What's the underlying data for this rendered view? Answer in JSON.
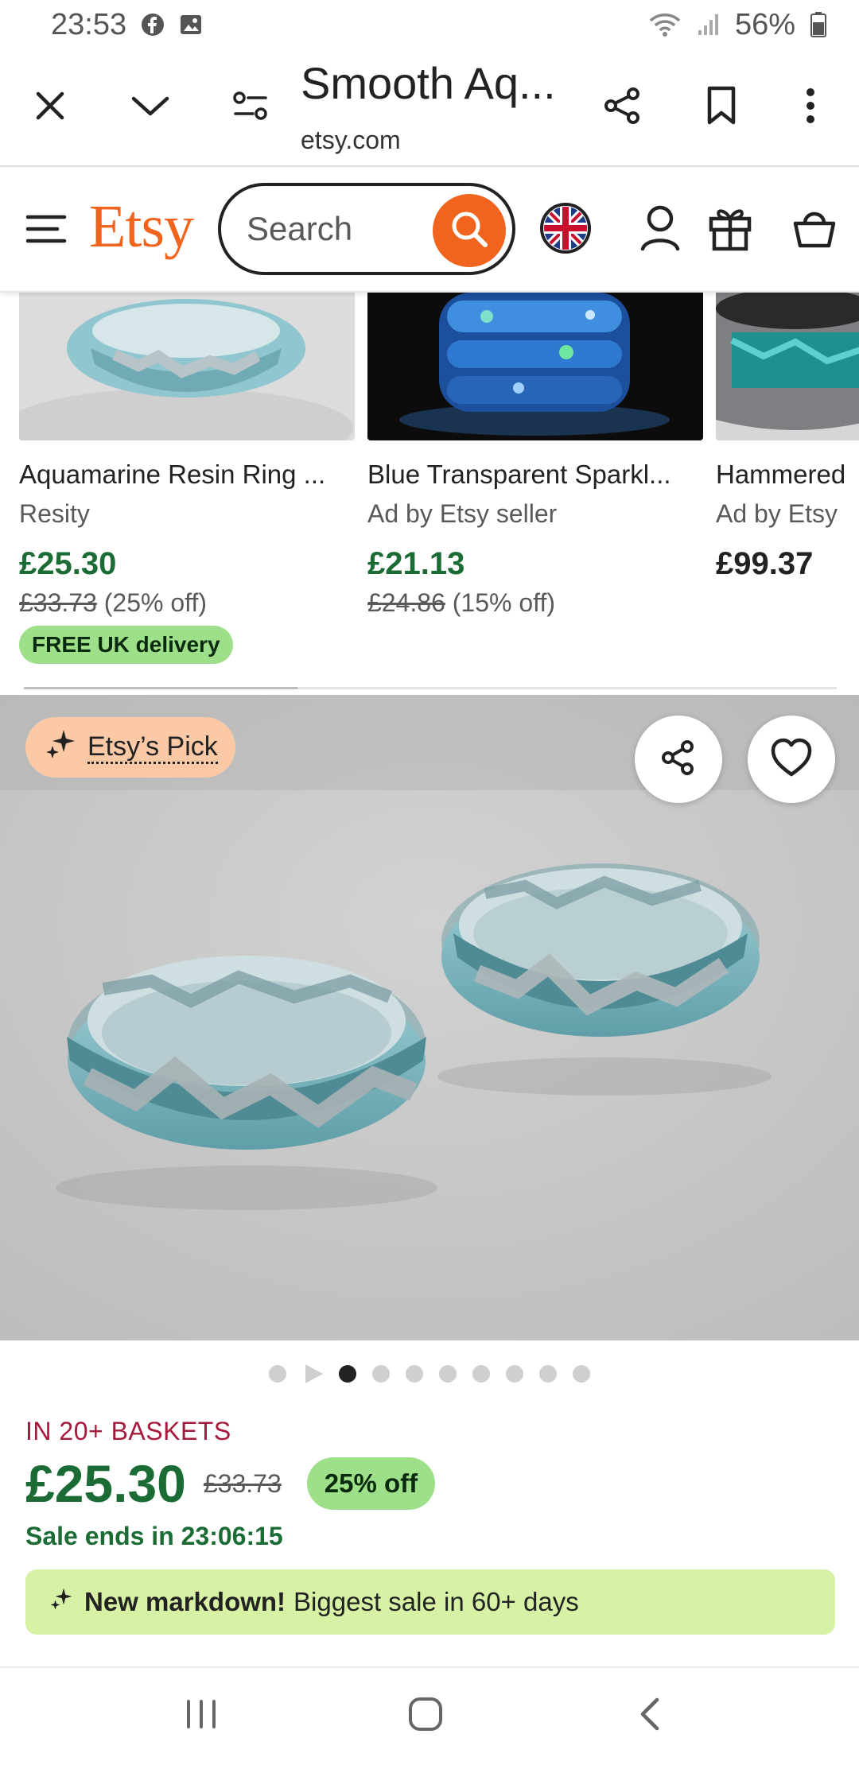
{
  "status_bar": {
    "time": "23:53",
    "battery": "56%",
    "icons": [
      "facebook-icon",
      "gallery-icon",
      "wifi-icon",
      "signal-icon",
      "battery-icon"
    ]
  },
  "browser": {
    "title": "Smooth Aq...",
    "domain": "etsy.com",
    "icons": [
      "close-icon",
      "chevron-down-icon",
      "site-settings-icon",
      "share-icon",
      "bookmark-icon",
      "more-icon"
    ]
  },
  "etsy_header": {
    "logo": "Etsy",
    "search_placeholder": "Search",
    "icons": [
      "menu-icon",
      "search-icon",
      "uk-flag-icon",
      "account-icon",
      "gift-icon",
      "basket-icon"
    ]
  },
  "listings": [
    {
      "title": "Aquamarine Resin Ring ...",
      "seller": "Resity",
      "price": "£25.30",
      "original_price": "£33.73",
      "discount": "(25% off)",
      "badge": "FREE UK delivery"
    },
    {
      "title": "Blue Transparent Sparkl...",
      "seller": "Ad by Etsy seller",
      "price": "£21.13",
      "original_price": "£24.86",
      "discount": "(15% off)"
    },
    {
      "title": "Hammered",
      "seller": "Ad by Etsy",
      "price": "£99.37"
    }
  ],
  "product": {
    "pick_label": "Etsy’s Pick",
    "image_count": 9,
    "active_image": 1,
    "baskets": "IN 20+ BASKETS",
    "price": "£25.30",
    "original_price": "£33.73",
    "discount_badge": "25% off",
    "sale_ends": "Sale ends in 23:06:15",
    "markdown_bold": "New markdown!",
    "markdown_rest": "Biggest sale in 60+ days"
  },
  "colors": {
    "etsy_orange": "#f1641e",
    "price_green": "#1b6c34",
    "badge_green": "#9ee089",
    "pick_peach": "#fcc9a6",
    "markdown_green": "#d7f2a5",
    "baskets_red": "#a61a3c"
  },
  "nav_bar": {
    "icons": [
      "recent-apps-icon",
      "home-icon",
      "back-icon"
    ]
  }
}
